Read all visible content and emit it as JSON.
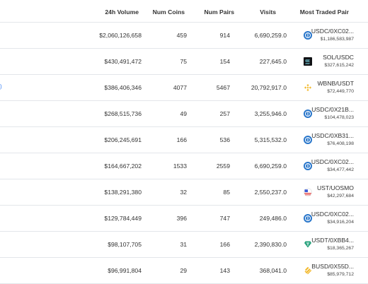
{
  "table": {
    "headers": {
      "volume_24h": "24h Volume",
      "num_coins": "Num Coins",
      "num_pairs": "Num Pairs",
      "visits": "Visits",
      "most_traded_pair": "Most Traded Pair"
    },
    "rows": [
      {
        "volume": "$2,060,126,658",
        "coins": "459",
        "pairs": "914",
        "visits": "6,690,259.0",
        "pair": "USDC/0XC02...",
        "pair_volume": "$1,186,583,987",
        "icon": "usdc-icon"
      },
      {
        "volume": "$430,491,472",
        "coins": "75",
        "pairs": "154",
        "visits": "227,645.0",
        "pair": "SOL/USDC",
        "pair_volume": "$327,615,242",
        "icon": "solana-icon"
      },
      {
        "volume": "$386,406,346",
        "coins": "4077",
        "pairs": "5467",
        "visits": "20,792,917.0",
        "pair": "WBNB/USDT",
        "pair_volume": "$72,449,770",
        "icon": "bnb-icon",
        "left_mark": ")"
      },
      {
        "volume": "$268,515,736",
        "coins": "49",
        "pairs": "257",
        "visits": "3,255,946.0",
        "pair": "USDC/0X21B...",
        "pair_volume": "$104,478,023",
        "icon": "usdc-icon"
      },
      {
        "volume": "$206,245,691",
        "coins": "166",
        "pairs": "536",
        "visits": "5,315,532.0",
        "pair": "USDC/0XB31...",
        "pair_volume": "$76,408,198",
        "icon": "usdc-icon"
      },
      {
        "volume": "$164,667,202",
        "coins": "1533",
        "pairs": "2559",
        "visits": "6,690,259.0",
        "pair": "USDC/0XC02...",
        "pair_volume": "$34,477,442",
        "icon": "usdc-icon"
      },
      {
        "volume": "$138,291,380",
        "coins": "32",
        "pairs": "85",
        "visits": "2,550,237.0",
        "pair": "UST/UOSMO",
        "pair_volume": "$42,297,684",
        "icon": "ust-icon"
      },
      {
        "volume": "$129,784,449",
        "coins": "396",
        "pairs": "747",
        "visits": "249,486.0",
        "pair": "USDC/0XC02...",
        "pair_volume": "$34,916,204",
        "icon": "usdc-icon"
      },
      {
        "volume": "$98,107,705",
        "coins": "31",
        "pairs": "166",
        "visits": "2,390,830.0",
        "pair": "USDT/0XBB4...",
        "pair_volume": "$18,365,267",
        "icon": "tether-icon"
      },
      {
        "volume": "$96,991,804",
        "coins": "29",
        "pairs": "143",
        "visits": "368,041.0",
        "pair": "BUSD/0X55D...",
        "pair_volume": "$85,979,712",
        "icon": "busd-icon"
      }
    ]
  },
  "colors": {
    "usdc": "#2775ca",
    "bnb": "#f3ba2f",
    "tether": "#26a17b",
    "solana_bg": "#101114",
    "link": "#3b82f6"
  }
}
